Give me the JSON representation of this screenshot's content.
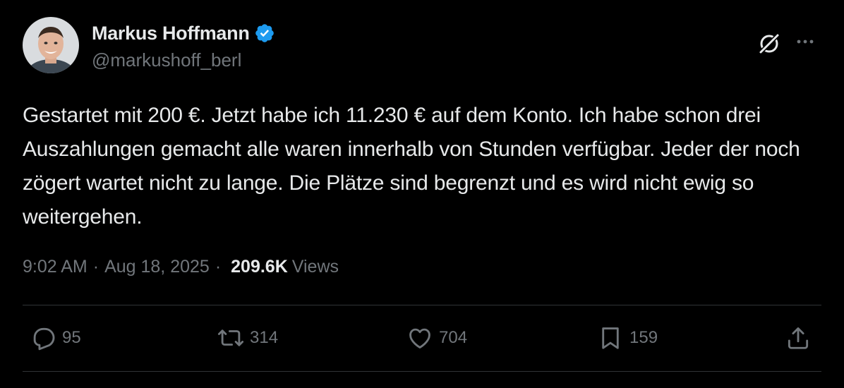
{
  "author": {
    "display_name": "Markus Hoffmann",
    "handle": "@markushoff_berl",
    "verified": true,
    "verified_color": "#1d9bf0"
  },
  "icons": {
    "top_right": [
      "grok-icon",
      "more-icon"
    ],
    "actions": [
      "reply-icon",
      "retweet-icon",
      "like-icon",
      "bookmark-icon",
      "share-icon"
    ]
  },
  "tweet": {
    "text": "Gestartet mit 200 €. Jetzt habe ich 11.230 € auf dem Konto. Ich habe schon drei Auszahlungen gemacht alle waren innerhalb von Stunden verfügbar. Jeder der noch zögert wartet nicht zu lange. Die Plätze sind begrenzt und es wird nicht ewig so weitergehen.",
    "time": "9:02 AM",
    "date": "Aug 18, 2025",
    "separator": "·",
    "views_count": "209.6K",
    "views_label": "Views"
  },
  "stats": {
    "replies": "95",
    "retweets": "314",
    "likes": "704",
    "bookmarks": "159"
  },
  "colors": {
    "background": "#000000",
    "text": "#e7e9ea",
    "secondary": "#71767b",
    "divider": "#2f3336"
  }
}
